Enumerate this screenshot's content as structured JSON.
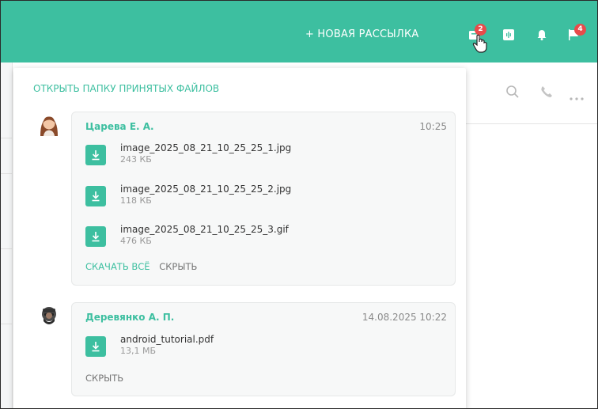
{
  "header": {
    "new_mailing_label": "+ НОВАЯ РАССЫЛКА",
    "accent": "#3dbfa0",
    "icons": [
      {
        "name": "file-inbox-icon",
        "badge": "2"
      },
      {
        "name": "voice-icon",
        "badge": ""
      },
      {
        "name": "bell-icon",
        "badge": ""
      },
      {
        "name": "flag-icon",
        "badge": "4"
      }
    ]
  },
  "popup": {
    "open_folder_label": "ОТКРЫТЬ ПАПКУ ПРИНЯТЫХ ФАЙЛОВ",
    "messages": [
      {
        "sender": "Царева Е. А.",
        "time": "10:25",
        "files": [
          {
            "name": "image_2025_08_21_10_25_25_1.jpg",
            "size": "243 КБ"
          },
          {
            "name": "image_2025_08_21_10_25_25_2.jpg",
            "size": "118 КБ"
          },
          {
            "name": "image_2025_08_21_10_25_25_3.gif",
            "size": "476 КБ"
          }
        ],
        "download_all_label": "СКАЧАТЬ ВСЁ",
        "hide_label": "СКРЫТЬ"
      },
      {
        "sender": "Деревянко А. П.",
        "time": "14.08.2025 10:22",
        "files": [
          {
            "name": "android_tutorial.pdf",
            "size": "13,1 МБ"
          }
        ],
        "hide_label": "СКРЫТЬ"
      }
    ]
  },
  "background": {
    "toolbar_icons": [
      "search-icon",
      "phone-icon",
      "more-icon"
    ]
  }
}
